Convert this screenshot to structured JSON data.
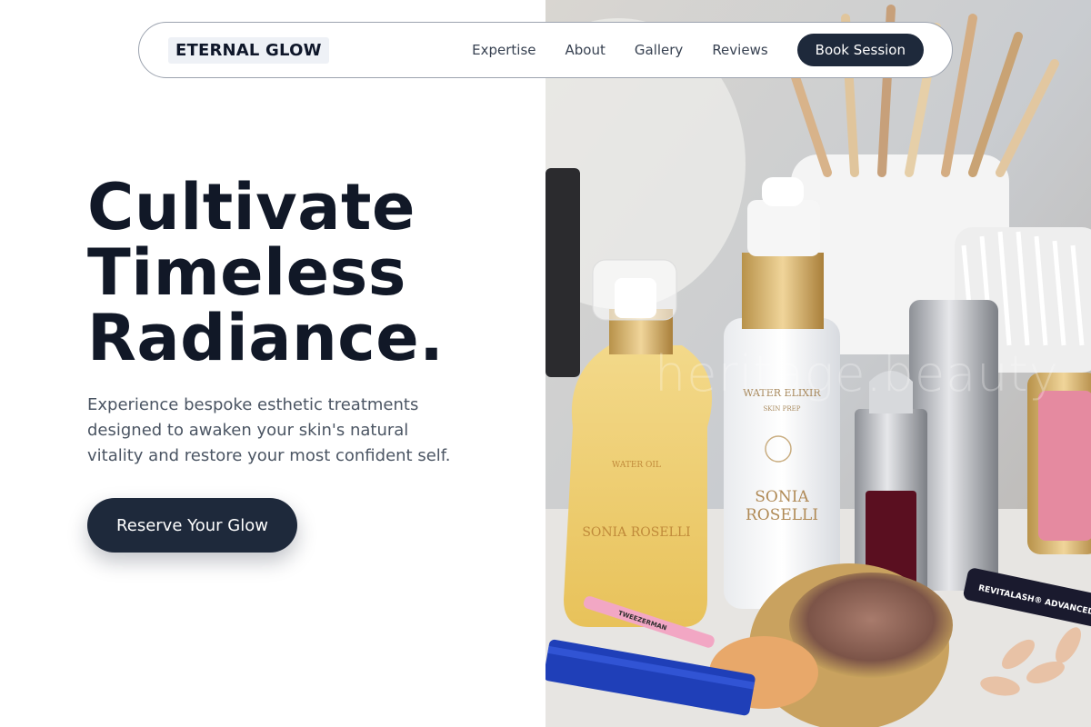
{
  "nav": {
    "brand": "ETERNAL GLOW",
    "links": [
      "Expertise",
      "About",
      "Gallery",
      "Reviews"
    ],
    "cta_label": "Book Session"
  },
  "hero": {
    "title_lines": [
      "Cultivate",
      "Timeless",
      "Radiance."
    ],
    "subtitle": "Experience bespoke esthetic treatments designed to awaken your skin's natural vitality and restore your most confident self.",
    "cta_label": "Reserve Your Glow"
  },
  "image": {
    "watermark": "heritage.beauty",
    "product_labels": {
      "oil_bottle_brand": "SONIA ROSELLI",
      "oil_bottle_name": "WATER OIL",
      "serum_name": "WATER ELIXIR",
      "serum_sub": "SKIN PREP",
      "serum_brand_line1": "SONIA",
      "serum_brand_line2": "ROSELLI",
      "tweezer_brand": "TWEEZERMAN",
      "lash_product": "REVITALASH® ADVANCED"
    }
  },
  "colors": {
    "primary": "#1e293b",
    "title": "#111827",
    "body_text": "#4b5563",
    "nav_border": "#9ca3af"
  }
}
